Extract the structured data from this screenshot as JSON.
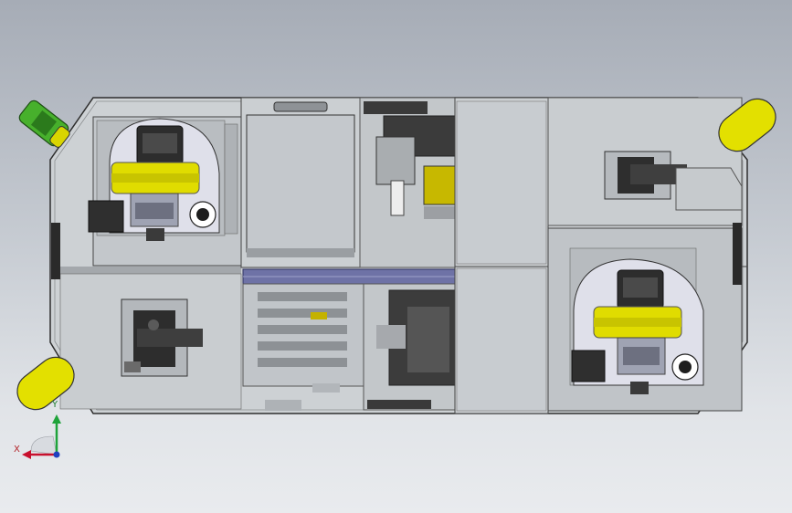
{
  "triad": {
    "x_label": "X",
    "y_label": "Y"
  },
  "colors": {
    "background_top": "#a6acb6",
    "background_bottom": "#e9ebee",
    "body_panel": "#cfd3d6",
    "edge": "#3a3a3a",
    "bumper_yellow": "#e3e000",
    "light_green": "#3c9e29",
    "rail_blue": "#6e72a6",
    "motor_disc": "#dedfe9",
    "axis_x": "#c8102e",
    "axis_y": "#1fa33a",
    "axis_z": "#1f3fbf"
  }
}
